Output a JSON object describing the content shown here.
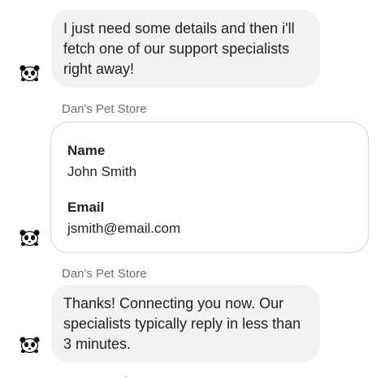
{
  "messages": [
    {
      "type": "text",
      "text": "I just need some details and then i'll fetch one of our support specialists right away!"
    },
    {
      "type": "form",
      "sender": "Dan's Pet Store",
      "fields": [
        {
          "label": "Name",
          "value": "John Smith"
        },
        {
          "label": "Email",
          "value": "jsmith@email.com"
        }
      ]
    },
    {
      "type": "text",
      "sender": "Dan's Pet Store",
      "text": "Thanks! Connecting you now. Our specialists typically reply in less than 3 minutes."
    }
  ],
  "avatar_icon": "panda-icon",
  "colors": {
    "bubble_bg": "#f1f2f4",
    "card_border": "#d3d5d9",
    "sender_text": "#6d6d72"
  }
}
